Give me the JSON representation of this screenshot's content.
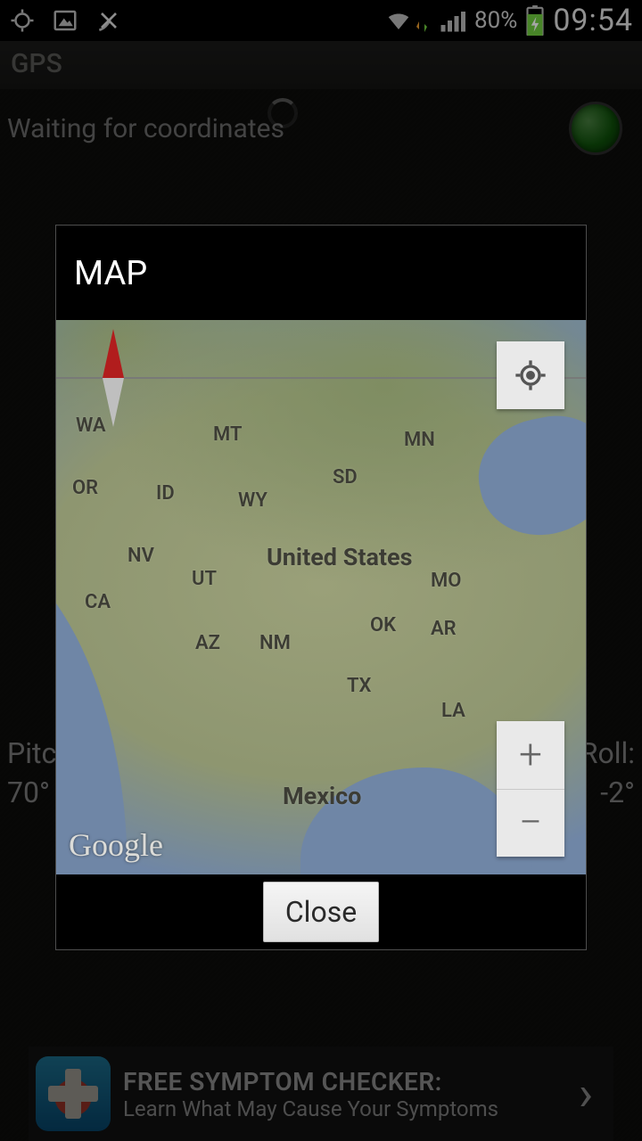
{
  "status_bar": {
    "battery_pct": "80%",
    "clock": "09:54"
  },
  "app": {
    "title": "GPS",
    "status_text": "Waiting for coordinates",
    "pitch_label": "Pitch:",
    "pitch_value": "70°",
    "roll_label": "Roll:",
    "roll_value": "-2°"
  },
  "dialog": {
    "title": "MAP",
    "close_label": "Close",
    "attribution": "Google"
  },
  "map": {
    "labels": {
      "wa": "WA",
      "mt": "MT",
      "mn": "MN",
      "or": "OR",
      "id": "ID",
      "wy": "WY",
      "sd": "SD",
      "nv": "NV",
      "ut": "UT",
      "ca": "CA",
      "mo": "MO",
      "az": "AZ",
      "nm": "NM",
      "ok": "OK",
      "ar": "AR",
      "tx": "TX",
      "la": "LA",
      "us": "United States",
      "mx": "Mexico"
    }
  },
  "ad": {
    "line1": "FREE SYMPTOM CHECKER:",
    "line2": "Learn What May Cause Your Symptoms"
  }
}
